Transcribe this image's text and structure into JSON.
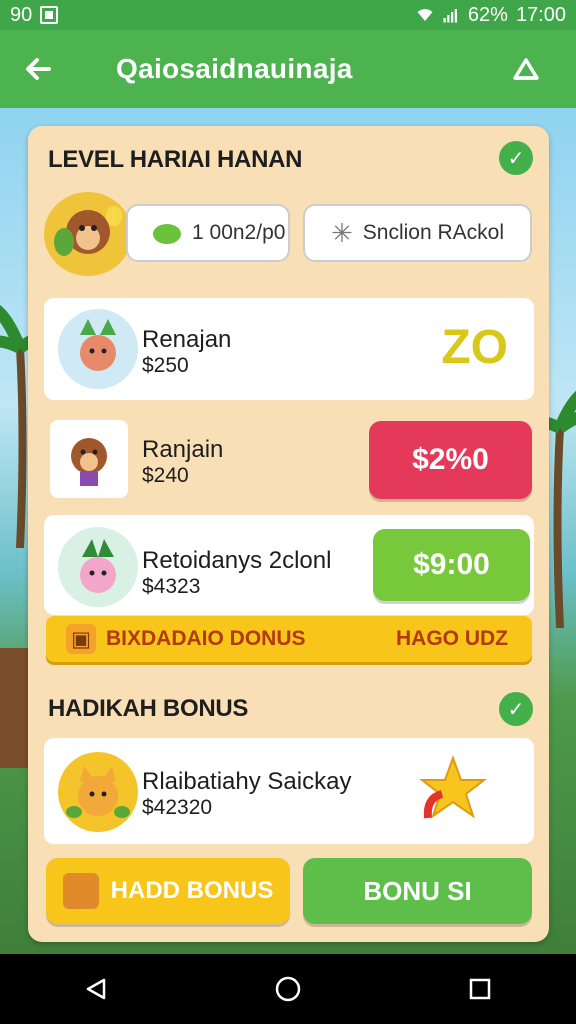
{
  "status_bar": {
    "left_number": "90",
    "battery": "62%",
    "time": "17:00",
    "icons": [
      "notification-icon",
      "wifi-icon",
      "signal-icon"
    ]
  },
  "app_bar": {
    "title": "Qaiosaidnauinaja",
    "back_icon": "arrow-left-icon",
    "home_icon": "home-icon"
  },
  "level_section": {
    "title": "LEVEL HARIAI HANAN",
    "counter_pill": "1 00n2/p0",
    "action_pill": "Snclion RAckol"
  },
  "items": [
    {
      "name": "Renajan",
      "price": "$250",
      "action": "ZO",
      "action_style": "text-yellow"
    },
    {
      "name": "Ranjain",
      "price": "$240",
      "action": "$2%0",
      "action_style": "red"
    },
    {
      "name": "Retoidanys 2clonl",
      "price": "$4323",
      "action": "$9:00",
      "action_style": "green"
    }
  ],
  "bonus_bar": {
    "left_label": "BIXDADAIO DONUS",
    "right_label": "HAGO UDZ"
  },
  "bonus_section": {
    "title": "HADIKAH BONUS",
    "item": {
      "name": "Rlaibatiahy Saickay",
      "price": "$42320"
    },
    "left_button": "HADD BONUS",
    "right_button": "BONU SI"
  },
  "colors": {
    "status_green": "#3fa74a",
    "appbar_green": "#4cb34f",
    "panel": "#f9dfb5",
    "red": "#e5395a",
    "green": "#78c83b",
    "yellow": "#f8c51a",
    "zo_yellow": "#d9c81c"
  }
}
